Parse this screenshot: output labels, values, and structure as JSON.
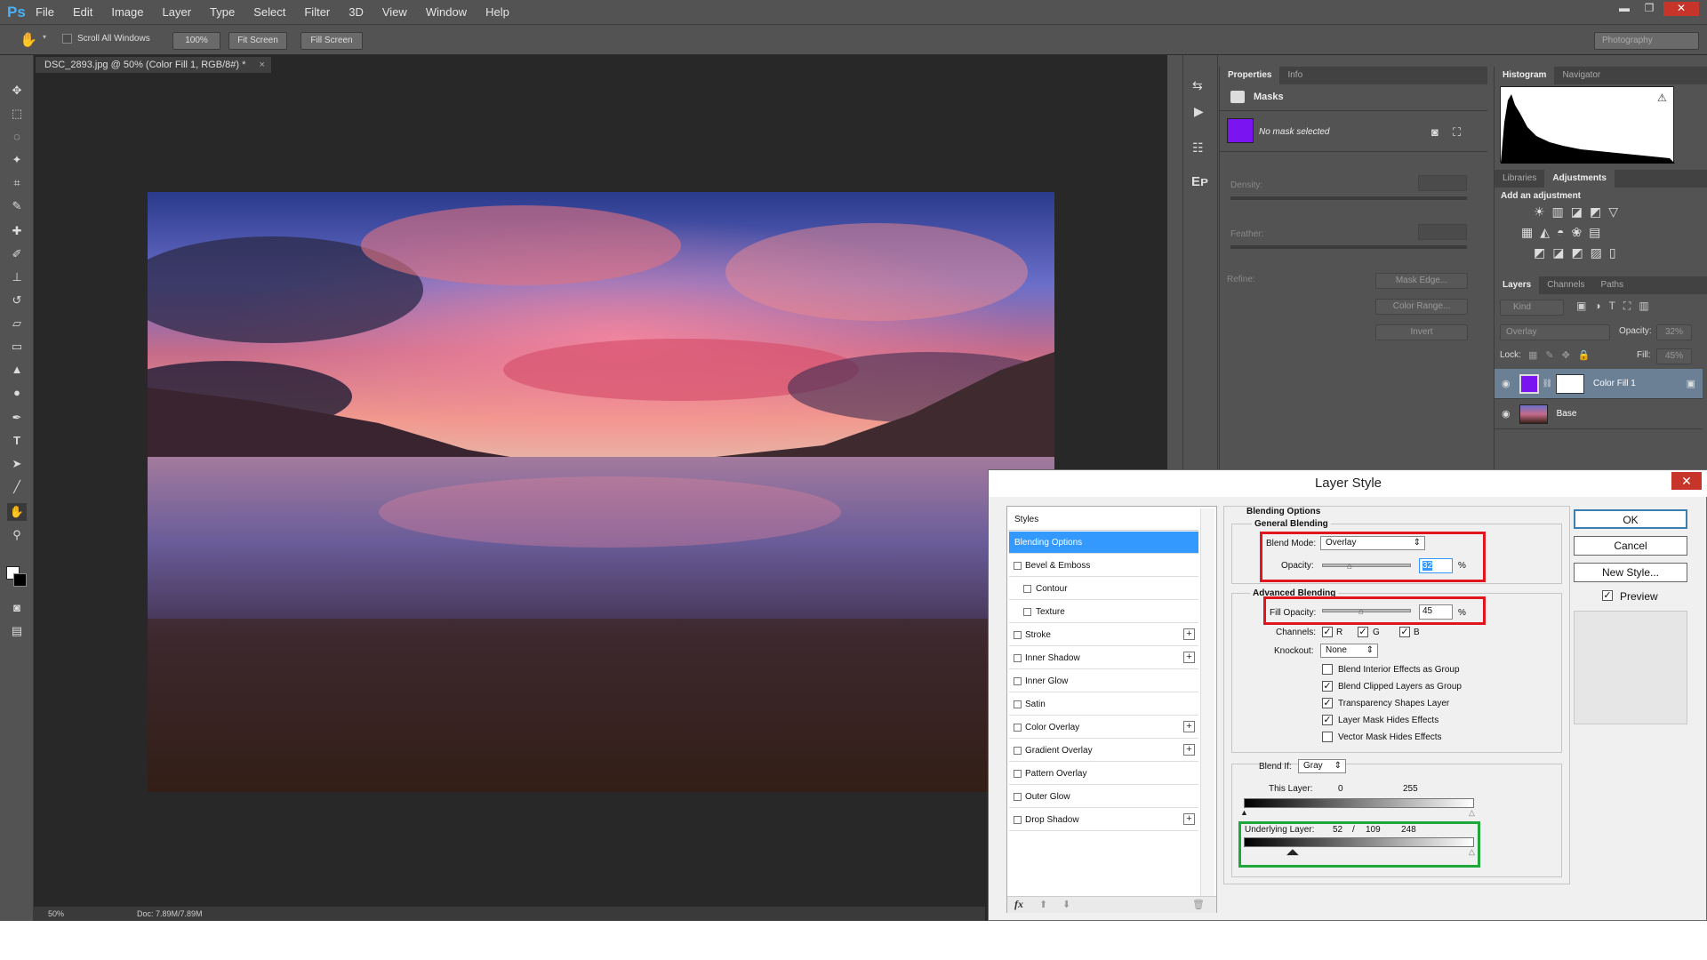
{
  "menubar": {
    "logo": "Ps",
    "items": [
      "File",
      "Edit",
      "Image",
      "Layer",
      "Type",
      "Select",
      "Filter",
      "3D",
      "View",
      "Window",
      "Help"
    ],
    "win_minimize": "▬",
    "win_restore": "❐",
    "win_close": "✕"
  },
  "options": {
    "scroll_all_label": "Scroll All Windows",
    "btn_zoom": "100%",
    "btn_fit": "Fit Screen",
    "btn_fill": "Fill Screen",
    "workspace": "Photography"
  },
  "document": {
    "tab_title": "DSC_2893.jpg @ 50% (Color Fill 1, RGB/8#) *",
    "tab_close": "×",
    "zoom": "50%",
    "doc_size": "Doc: 7.89M/7.89M"
  },
  "properties": {
    "tabs": [
      "Properties",
      "Info"
    ],
    "section": "Masks",
    "no_mask": "No mask selected",
    "density_label": "Density:",
    "feather_label": "Feather:",
    "refine_label": "Refine:",
    "btn_mask_edge": "Mask Edge...",
    "btn_color_range": "Color Range...",
    "btn_invert": "Invert"
  },
  "histogram": {
    "tabs": [
      "Histogram",
      "Navigator"
    ]
  },
  "adjustments": {
    "tabs": [
      "Libraries",
      "Adjustments"
    ],
    "title": "Add an adjustment"
  },
  "layers": {
    "tabs": [
      "Layers",
      "Channels",
      "Paths"
    ],
    "kind_label": "Kind",
    "blend_mode": "Overlay",
    "opacity_label": "Opacity:",
    "opacity_value": "32%",
    "lock_label": "Lock:",
    "fill_label": "Fill:",
    "fill_value": "45%",
    "items": [
      {
        "name": "Color Fill 1"
      },
      {
        "name": "Base"
      }
    ]
  },
  "dialog": {
    "title": "Layer Style",
    "close": "✕",
    "styles_header": "Styles",
    "style_items": [
      "Blending Options",
      "Bevel & Emboss",
      "Contour",
      "Texture",
      "Stroke",
      "Inner Shadow",
      "Inner Glow",
      "Satin",
      "Color Overlay",
      "Gradient Overlay",
      "Pattern Overlay",
      "Outer Glow",
      "Drop Shadow"
    ],
    "plus_sign": "+",
    "fx_label": "fx",
    "blending_options": "Blending Options",
    "general_blending": "General Blending",
    "blend_mode_label": "Blend Mode:",
    "blend_mode_value": "Overlay",
    "opacity_label": "Opacity:",
    "opacity_value": "32",
    "opacity_fraction": 0.32,
    "pct": "%",
    "advanced_blending": "Advanced Blending",
    "fill_opacity_label": "Fill Opacity:",
    "fill_opacity_value": "45",
    "fill_opacity_fraction": 0.45,
    "channels_label": "Channels:",
    "channel_r": "R",
    "channel_g": "G",
    "channel_b": "B",
    "knockout_label": "Knockout:",
    "knockout_value": "None",
    "options": [
      {
        "label": "Blend Interior Effects as Group",
        "checked": false
      },
      {
        "label": "Blend Clipped Layers as Group",
        "checked": true
      },
      {
        "label": "Transparency Shapes Layer",
        "checked": true
      },
      {
        "label": "Layer Mask Hides Effects",
        "checked": true
      },
      {
        "label": "Vector Mask Hides Effects",
        "checked": false
      }
    ],
    "blend_if_label": "Blend If:",
    "blend_if_value": "Gray",
    "this_layer_label": "This Layer:",
    "this_layer_low": "0",
    "this_layer_high": "255",
    "underlying_label": "Underlying Layer:",
    "underlying_v1": "52",
    "underlying_slash": "/",
    "underlying_v2": "109",
    "underlying_v3": "248",
    "btn_ok": "OK",
    "btn_cancel": "Cancel",
    "btn_new_style": "New Style...",
    "preview_label": "Preview",
    "preview_checked": true
  },
  "colors": {
    "fill_swatch": "#7a14f0",
    "selection_blue": "#3399ff",
    "highlight_red": "#e0151d",
    "highlight_green": "#1ea83b"
  }
}
